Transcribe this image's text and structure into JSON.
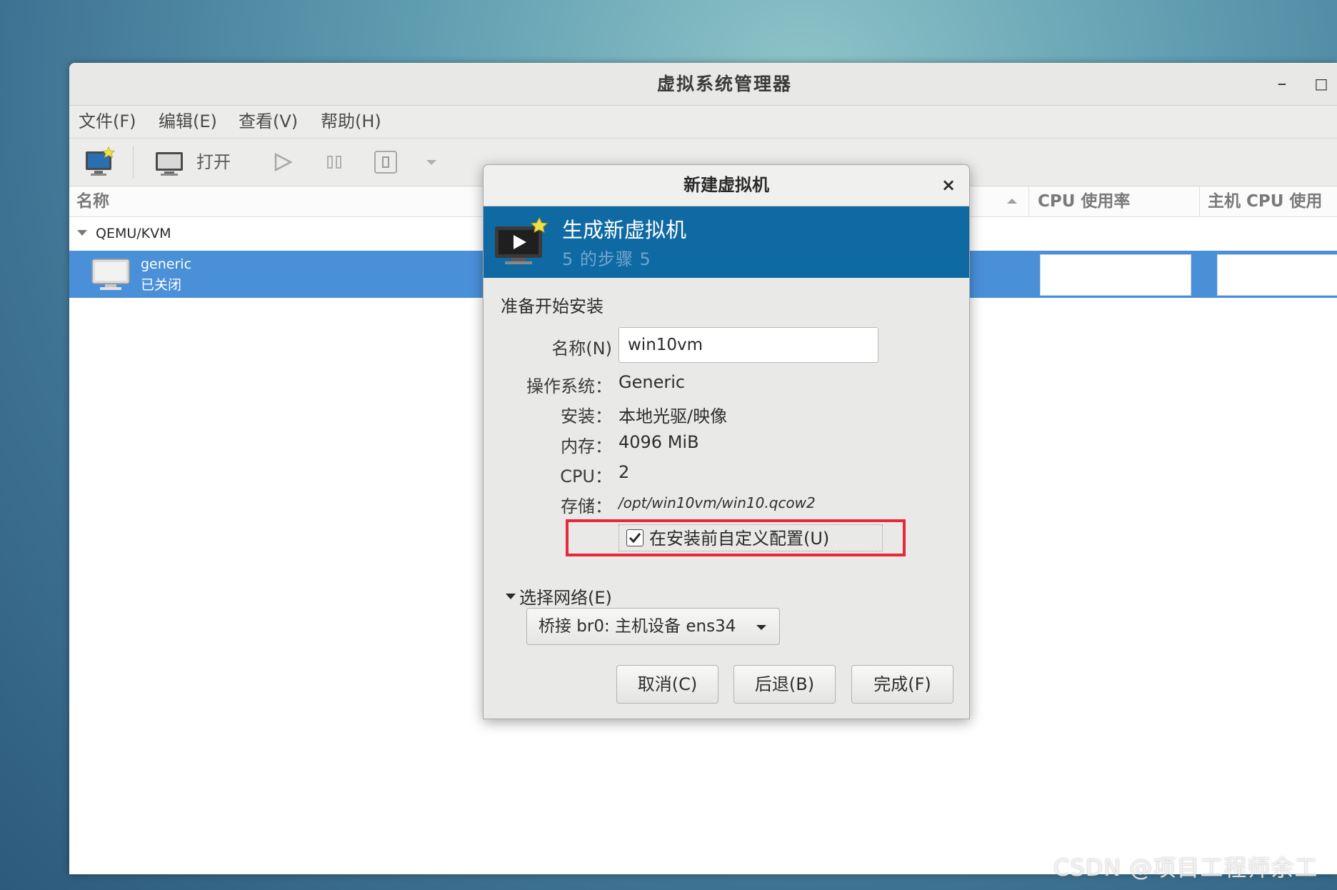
{
  "window": {
    "title": "虚拟系统管理器",
    "minimize_glyph": "–",
    "maximize_glyph": "□"
  },
  "menu": [
    "文件(F)",
    "编辑(E)",
    "查看(V)",
    "帮助(H)"
  ],
  "toolbar": {
    "new_vm_icon": "new-vm-icon",
    "open_label": "打开",
    "run_icon": "play-icon",
    "pause_icon": "pause-icon",
    "stop_icon": "stop-icon",
    "dropdown_icon": "chevron-down-icon"
  },
  "list": {
    "columns": {
      "name": "名称",
      "cpu_usage": "CPU 使用率",
      "host_cpu_usage": "主机 CPU 使用"
    },
    "group": "QEMU/KVM",
    "vm": {
      "name": "generic",
      "status": "已关闭"
    }
  },
  "dialog": {
    "title": "新建虚拟机",
    "close_glyph": "×",
    "banner_title": "生成新虚拟机",
    "banner_step": "5 的步骤 5",
    "section_title": "准备开始安装",
    "name_label": "名称(N)",
    "name_value": "win10vm",
    "os_label": "操作系统：",
    "os_value": "Generic",
    "install_label": "安装：",
    "install_value": "本地光驱/映像",
    "memory_label": "内存：",
    "memory_value": "4096 MiB",
    "cpu_label": "CPU：",
    "cpu_value": "2",
    "storage_label": "存储：",
    "storage_value": "/opt/win10vm/win10.qcow2",
    "customize_label": "在安装前自定义配置(U)",
    "customize_checked": true,
    "network_expander": "选择网络(E)",
    "network_value": "桥接 br0: 主机设备 ens34",
    "buttons": {
      "cancel": "取消(C)",
      "back": "后退(B)",
      "finish": "完成(F)"
    }
  },
  "colors": {
    "selection": "#4a90d9",
    "banner": "#0f6aa4",
    "highlight": "#e8283a"
  },
  "watermark": "CSDN @项目工程师余工"
}
